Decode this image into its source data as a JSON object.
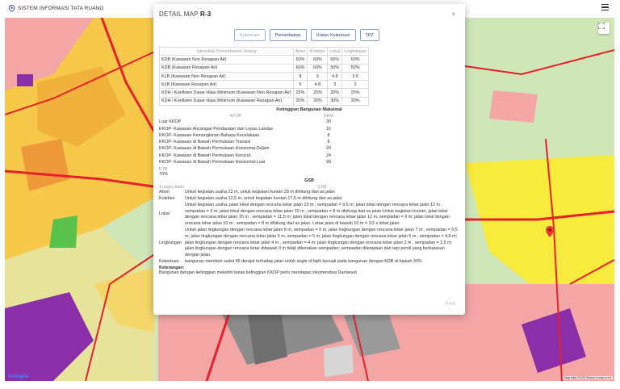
{
  "app": {
    "title": "SISTEM INFORMASI TATA RUANG"
  },
  "map": {
    "fullscreen_icon": "fullscreen-icon",
    "google_label": "Google",
    "attribution": "Map data ©2020  Report a map error",
    "marker_icon": "map-pin-icon"
  },
  "modal": {
    "title_prefix": "DETAIL MAP",
    "title_code": "R-3",
    "close": "×",
    "print": "Print"
  },
  "tabs": [
    "Ketentuan",
    "Pemanfaatan",
    "Uraian Ketentuan",
    "TPZ"
  ],
  "itr": {
    "headers": [
      "Intensitas Pemanfaatan Ruang",
      "Arteri",
      "Kolektor",
      "Lokal",
      "Lingkungan"
    ],
    "rows": [
      [
        "KDB (Kawasan Non Resapan Air)",
        "60%",
        "60%",
        "60%",
        "60%"
      ],
      [
        "KDB (Kawasan Resapan Air)",
        "60%",
        "60%",
        "50%",
        "50%"
      ],
      [
        "KLB (Kawasan Non Resapan Air)",
        "8",
        "6",
        "4.8",
        "3.6"
      ],
      [
        "KLB (Kawasan Resapan Air)",
        "6",
        "4.8",
        "3",
        "2"
      ],
      [
        "KDH / Koefisien Dasar Hijau Minimum (Kawasan Non Resapan Air)",
        "25%",
        "25%",
        "25%",
        "25%"
      ],
      [
        "KDH / Koefisien Dasar Hijau Minimum (Kawasan Resapan Air)",
        "30%",
        "30%",
        "30%",
        "30%"
      ]
    ]
  },
  "kbm": {
    "title": "Ketinggian Bangunan Maksimal",
    "col1": "KKOP",
    "col2": "KBM",
    "rows": [
      [
        "Luar KKOP",
        "30"
      ],
      [
        "KKOP- Kawasan Ancangan Pendaratan dan Lepas Landas",
        "16"
      ],
      [
        "KKOP- Kawasan Kemungkinan Bahaya Kecelakaan",
        "8"
      ],
      [
        "KKOP- Kawasan di Bawah Permukaan Transisi",
        "8"
      ],
      [
        "KKOP- Kawasan di Bawah Permukaan Horizontal-Dalam",
        "20"
      ],
      [
        "KKOP- Kawasan di Bawah Permukaan Kerucut",
        "24"
      ],
      [
        "KKOP- Kawasan di Bawah Permukaan Horizontal-Luar",
        "28"
      ]
    ]
  },
  "ktb": {
    "label": "KTB",
    "value": "70%"
  },
  "gsb": {
    "title": "GSB",
    "col1": "Fungsi Jalan",
    "col2": "GSB",
    "rows": [
      [
        "Arteri",
        "Untuk kegiatan usaha 22 m, untuk kegiatan hunian 29 m dihitung dari as jalan"
      ],
      [
        "Kolektor",
        "Untuk kegiatan usaha 12,5 m, untuk kegiatan hunian 17,5 m dihitung dari as jalan"
      ],
      [
        "Lokal",
        "Untuk kegiatan usaha, jalan lokal dengan rencana lebar jalan 15 m , sempadan = 9,5 m; jalan lokal dengan rencana lebar jalan 12 m , sempadan = 9 m; jalan lokal dengan rencana lebar jalan 10 m , sempadan = 8 m dihitung dari as jalan.Untuk kegiatan hunian, jalan lokal dengan rencana lebar jalan 15 m , sempadan = 11,5 m; jalan lokal dengan rencana lebar jalan 12 m, sempadan = 9 m; jalan lokal dengan rencana lebar jalan 10 m , sempadan = 8 m dihitung dari as jalan. Lebar jalan di bawah 10 m = 1/2 x lebar jalan."
      ],
      [
        "Lingkungan",
        "Untuk jalan lingkungan dengan rencana lebar jalan 8 m, sempadan = 6 m; jalan lingkungan dengan rencana lebar jalan 7 m , sempadan = 5,5 m; jalan lingkungan dengan rencana lebar jalan 6 m, sempadan = 5 m; jalan lingkungan dengan rencana lebar jalan 5 m , sempadan = 4,5 m; jalan lingkungan dengan rencana lebar jalan 4 m , sempadan = 4 m; jalan lingkungan dengan rencana lebar jalan 3 m , sempadan = 3,5 m; jalan lingkungan dengan rencana lebar dibawah 3 m tidak dikenakan sempadan; sempadan ditetapkan dari tepi persil yang berbatasan dengan jalan."
      ],
      [
        "Ketentuan",
        "bangunan memberi sudut 45 derajat terhadap jalan untuk angle of light kecuali pada bangunan dengan KDB di bawah 30%"
      ]
    ]
  },
  "keterangan": {
    "label": "Keterangan:",
    "text": "Bangunan dengan ketinggian melebihi batas ketinggian KKOP perlu mendapat rekomendasi Danlanud"
  }
}
